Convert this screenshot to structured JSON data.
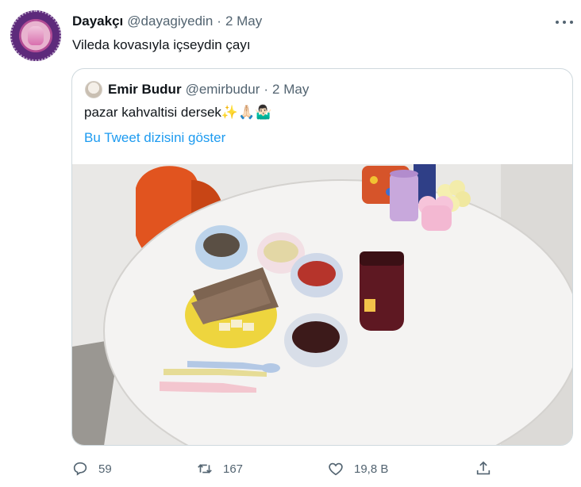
{
  "tweet": {
    "author_name": "Dayakçı",
    "author_handle": "@dayagiyedin",
    "separator": "·",
    "date": "2 May",
    "text": "Vileda kovasıyla içseydin çayı"
  },
  "quoted_tweet": {
    "author_name": "Emir Budur",
    "author_handle": "@emirbudur",
    "separator": "·",
    "date": "2 May",
    "text": "pazar kahvaltisi dersek",
    "emojis": "✨🙏🏻🤷🏻‍♂️",
    "thread_link": "Bu Tweet dizisini göster"
  },
  "actions": {
    "reply_count": "59",
    "retweet_count": "167",
    "like_count": "19,8 B"
  },
  "icons": {
    "reply": "reply-icon",
    "retweet": "retweet-icon",
    "like": "heart-icon",
    "share": "share-icon",
    "more": "more-icon"
  },
  "colors": {
    "link": "#1d9bf0",
    "secondary_text": "#536471",
    "border": "#cfd9de"
  }
}
